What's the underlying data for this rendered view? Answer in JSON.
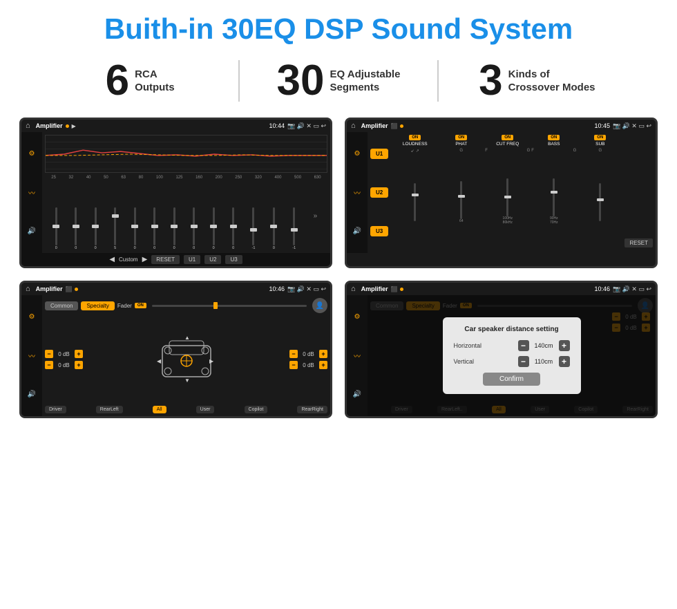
{
  "header": {
    "title": "Buith-in 30EQ DSP Sound System"
  },
  "stats": [
    {
      "number": "6",
      "label": "RCA\nOutputs"
    },
    {
      "number": "30",
      "label": "EQ Adjustable\nSegments"
    },
    {
      "number": "3",
      "label": "Kinds of\nCrossover Modes"
    }
  ],
  "screens": {
    "eq": {
      "status_title": "Amplifier",
      "time": "10:44",
      "freqs": [
        "25",
        "32",
        "40",
        "50",
        "63",
        "80",
        "100",
        "125",
        "160",
        "200",
        "250",
        "320",
        "400",
        "500",
        "630"
      ],
      "values": [
        "0",
        "0",
        "0",
        "5",
        "0",
        "0",
        "0",
        "0",
        "0",
        "0",
        "-1",
        "0",
        "-1"
      ],
      "preset": "Custom",
      "buttons": [
        "RESET",
        "U1",
        "U2",
        "U3"
      ]
    },
    "crossover": {
      "status_title": "Amplifier",
      "time": "10:45",
      "presets": [
        "U1",
        "U2",
        "U3"
      ],
      "columns": [
        {
          "on": true,
          "label": "LOUDNESS"
        },
        {
          "on": true,
          "label": "PHAT"
        },
        {
          "on": true,
          "label": "CUT FREQ"
        },
        {
          "on": true,
          "label": "BASS"
        },
        {
          "on": true,
          "label": "SUB"
        }
      ]
    },
    "fader": {
      "status_title": "Amplifier",
      "time": "10:46",
      "tabs": [
        "Common",
        "Specialty"
      ],
      "active_tab": "Specialty",
      "fader_label": "Fader",
      "on_label": "ON",
      "vol_rows": [
        "0 dB",
        "0 dB",
        "0 dB",
        "0 dB"
      ],
      "bottom_btns": [
        "Driver",
        "RearLeft",
        "All",
        "User",
        "Copilot",
        "RearRight"
      ]
    },
    "distance": {
      "status_title": "Amplifier",
      "time": "10:46",
      "tabs": [
        "Common",
        "Specialty"
      ],
      "dialog": {
        "title": "Car speaker distance setting",
        "horizontal_label": "Horizontal",
        "horizontal_value": "140cm",
        "vertical_label": "Vertical",
        "vertical_value": "110cm",
        "confirm_label": "Confirm"
      },
      "vol_rows": [
        "0 dB",
        "0 dB"
      ],
      "bottom_btns": [
        "Driver",
        "RearLeft..",
        "All",
        "User",
        "Copilot",
        "RearRight"
      ]
    }
  }
}
